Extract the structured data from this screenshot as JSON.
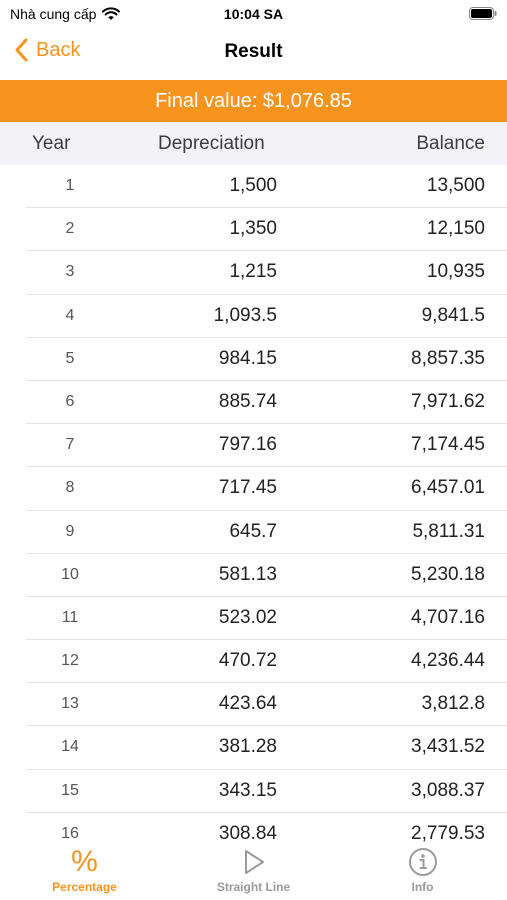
{
  "status_bar": {
    "carrier": "Nhà cung cấp",
    "time": "10:04 SA",
    "wifi_icon": "wifi-icon",
    "battery_icon": "battery-icon"
  },
  "nav": {
    "back_label": "Back",
    "title": "Result"
  },
  "banner": {
    "text": "Final value: $1,076.85"
  },
  "table": {
    "headers": {
      "year": "Year",
      "depreciation": "Depreciation",
      "balance": "Balance"
    },
    "rows": [
      {
        "year": "1",
        "depreciation": "1,500",
        "balance": "13,500"
      },
      {
        "year": "2",
        "depreciation": "1,350",
        "balance": "12,150"
      },
      {
        "year": "3",
        "depreciation": "1,215",
        "balance": "10,935"
      },
      {
        "year": "4",
        "depreciation": "1,093.5",
        "balance": "9,841.5"
      },
      {
        "year": "5",
        "depreciation": "984.15",
        "balance": "8,857.35"
      },
      {
        "year": "6",
        "depreciation": "885.74",
        "balance": "7,971.62"
      },
      {
        "year": "7",
        "depreciation": "797.16",
        "balance": "7,174.45"
      },
      {
        "year": "8",
        "depreciation": "717.45",
        "balance": "6,457.01"
      },
      {
        "year": "9",
        "depreciation": "645.7",
        "balance": "5,811.31"
      },
      {
        "year": "10",
        "depreciation": "581.13",
        "balance": "5,230.18"
      },
      {
        "year": "11",
        "depreciation": "523.02",
        "balance": "4,707.16"
      },
      {
        "year": "12",
        "depreciation": "470.72",
        "balance": "4,236.44"
      },
      {
        "year": "13",
        "depreciation": "423.64",
        "balance": "3,812.8"
      },
      {
        "year": "14",
        "depreciation": "381.28",
        "balance": "3,431.52"
      },
      {
        "year": "15",
        "depreciation": "343.15",
        "balance": "3,088.37"
      },
      {
        "year": "16",
        "depreciation": "308.84",
        "balance": "2,779.53"
      }
    ]
  },
  "tabs": [
    {
      "label": "Percentage",
      "icon": "percent-icon",
      "active": true
    },
    {
      "label": "Straight Line",
      "icon": "play-icon",
      "active": false
    },
    {
      "label": "Info",
      "icon": "info-icon",
      "active": false
    }
  ],
  "colors": {
    "accent": "#f7941d",
    "header_bg": "#f2f2f7",
    "inactive": "#9a9a9a"
  }
}
